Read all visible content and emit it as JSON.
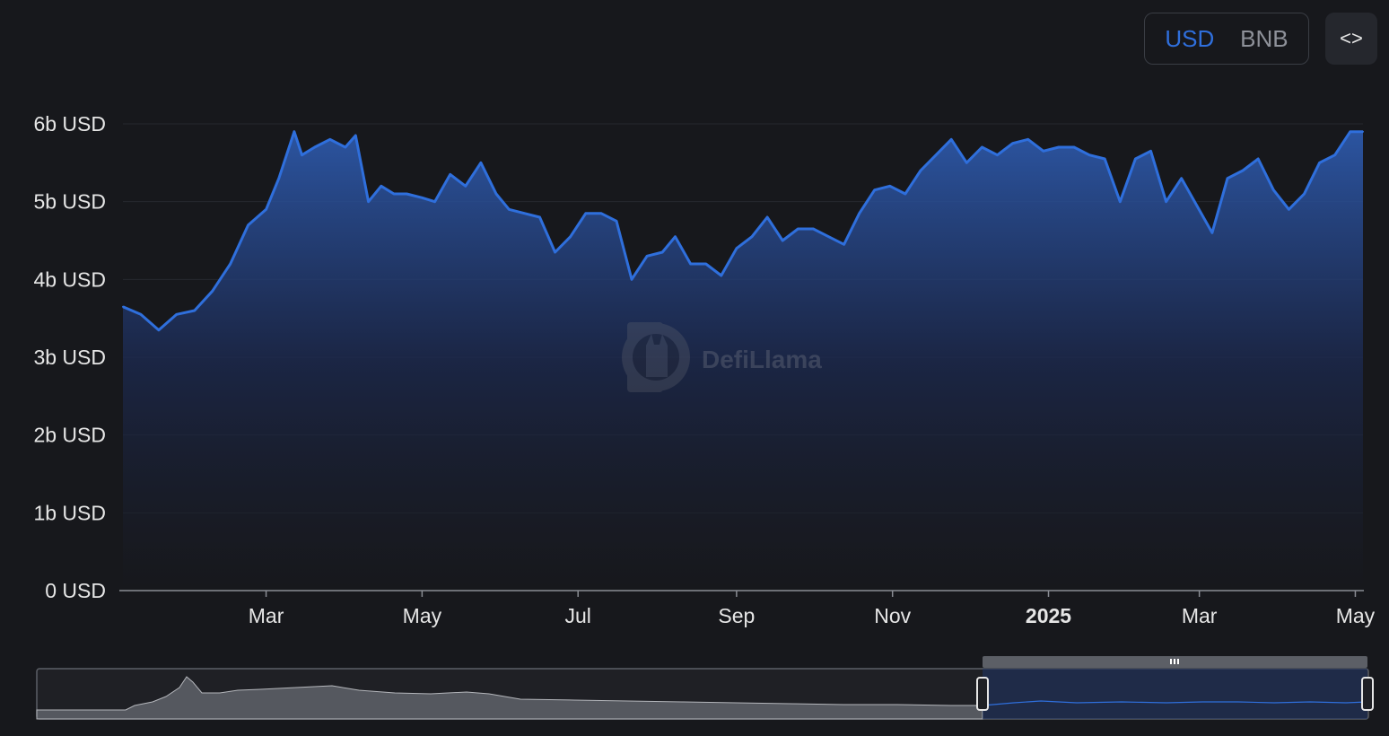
{
  "toggle": {
    "usd_label": "USD",
    "bnb_label": "BNB",
    "selected": "USD"
  },
  "embed": {
    "icon": "code-icon",
    "label": "<>"
  },
  "watermark": {
    "text": "DefiLlama",
    "icon": "llama-logo-icon"
  },
  "colors": {
    "line": "#2f6fdc",
    "accent": "#2f6fdc",
    "background": "#17181c"
  },
  "chart_data": {
    "type": "area",
    "title": "",
    "xlabel": "",
    "ylabel": "",
    "unit": "USD",
    "grid": true,
    "ylim": [
      0,
      6000000000
    ],
    "y_ticks": [
      {
        "value": 0,
        "label": "0 USD"
      },
      {
        "value": 1000000000,
        "label": "1b USD"
      },
      {
        "value": 2000000000,
        "label": "2b USD"
      },
      {
        "value": 3000000000,
        "label": "3b USD"
      },
      {
        "value": 4000000000,
        "label": "4b USD"
      },
      {
        "value": 5000000000,
        "label": "5b USD"
      },
      {
        "value": 6000000000,
        "label": "6b USD"
      }
    ],
    "xlim": [
      "2024-01-05",
      "2025-05-04"
    ],
    "x_ticks": [
      {
        "date": "2024-03-01",
        "label": "Mar",
        "bold": false
      },
      {
        "date": "2024-05-01",
        "label": "May",
        "bold": false
      },
      {
        "date": "2024-07-01",
        "label": "Jul",
        "bold": false
      },
      {
        "date": "2024-09-01",
        "label": "Sep",
        "bold": false
      },
      {
        "date": "2024-11-01",
        "label": "Nov",
        "bold": false
      },
      {
        "date": "2025-01-01",
        "label": "2025",
        "bold": true
      },
      {
        "date": "2025-03-01",
        "label": "Mar",
        "bold": false
      },
      {
        "date": "2025-05-01",
        "label": "May",
        "bold": false
      }
    ],
    "series": [
      {
        "x": [
          "2024-01-05",
          "2024-01-12",
          "2024-01-19",
          "2024-01-26",
          "2024-02-02",
          "2024-02-09",
          "2024-02-16",
          "2024-02-23",
          "2024-03-01",
          "2024-03-06",
          "2024-03-12",
          "2024-03-15",
          "2024-03-20",
          "2024-03-26",
          "2024-04-01",
          "2024-04-05",
          "2024-04-10",
          "2024-04-15",
          "2024-04-20",
          "2024-04-25",
          "2024-05-01",
          "2024-05-06",
          "2024-05-12",
          "2024-05-18",
          "2024-05-24",
          "2024-05-30",
          "2024-06-04",
          "2024-06-10",
          "2024-06-16",
          "2024-06-22",
          "2024-06-28",
          "2024-07-04",
          "2024-07-10",
          "2024-07-16",
          "2024-07-22",
          "2024-07-28",
          "2024-08-03",
          "2024-08-08",
          "2024-08-14",
          "2024-08-20",
          "2024-08-26",
          "2024-09-01",
          "2024-09-07",
          "2024-09-13",
          "2024-09-19",
          "2024-09-25",
          "2024-10-01",
          "2024-10-07",
          "2024-10-13",
          "2024-10-19",
          "2024-10-25",
          "2024-10-31",
          "2024-11-06",
          "2024-11-12",
          "2024-11-18",
          "2024-11-24",
          "2024-11-30",
          "2024-12-06",
          "2024-12-12",
          "2024-12-18",
          "2024-12-24",
          "2024-12-30",
          "2025-01-05",
          "2025-01-11",
          "2025-01-17",
          "2025-01-23",
          "2025-01-29",
          "2025-02-04",
          "2025-02-10",
          "2025-02-16",
          "2025-02-22",
          "2025-02-28",
          "2025-03-06",
          "2025-03-12",
          "2025-03-18",
          "2025-03-24",
          "2025-03-30",
          "2025-04-05",
          "2025-04-11",
          "2025-04-17",
          "2025-04-23",
          "2025-04-29",
          "2025-05-04"
        ],
        "y": [
          3650000000,
          3550000000,
          3350000000,
          3550000000,
          3600000000,
          3850000000,
          4200000000,
          4700000000,
          4900000000,
          5300000000,
          5900000000,
          5600000000,
          5700000000,
          5800000000,
          5700000000,
          5850000000,
          5000000000,
          5200000000,
          5100000000,
          5100000000,
          5050000000,
          5000000000,
          5350000000,
          5200000000,
          5500000000,
          5100000000,
          4900000000,
          4850000000,
          4800000000,
          4350000000,
          4550000000,
          4850000000,
          4850000000,
          4750000000,
          4000000000,
          4300000000,
          4350000000,
          4550000000,
          4200000000,
          4200000000,
          4050000000,
          4400000000,
          4550000000,
          4800000000,
          4500000000,
          4650000000,
          4650000000,
          4550000000,
          4450000000,
          4850000000,
          5150000000,
          5200000000,
          5100000000,
          5400000000,
          5600000000,
          5800000000,
          5500000000,
          5700000000,
          5600000000,
          5750000000,
          5800000000,
          5650000000,
          5700000000,
          5700000000,
          5600000000,
          5550000000,
          5000000000,
          5550000000,
          5650000000,
          5000000000,
          5300000000,
          4950000000,
          4600000000,
          5300000000,
          5400000000,
          5550000000,
          5150000000,
          4900000000,
          5100000000,
          5500000000,
          5600000000,
          5900000000,
          5900000000
        ]
      }
    ],
    "navigator": {
      "full_range": [
        "2021-01-01",
        "2025-05-04"
      ],
      "selected_range": [
        "2024-01-05",
        "2025-05-04"
      ]
    }
  }
}
